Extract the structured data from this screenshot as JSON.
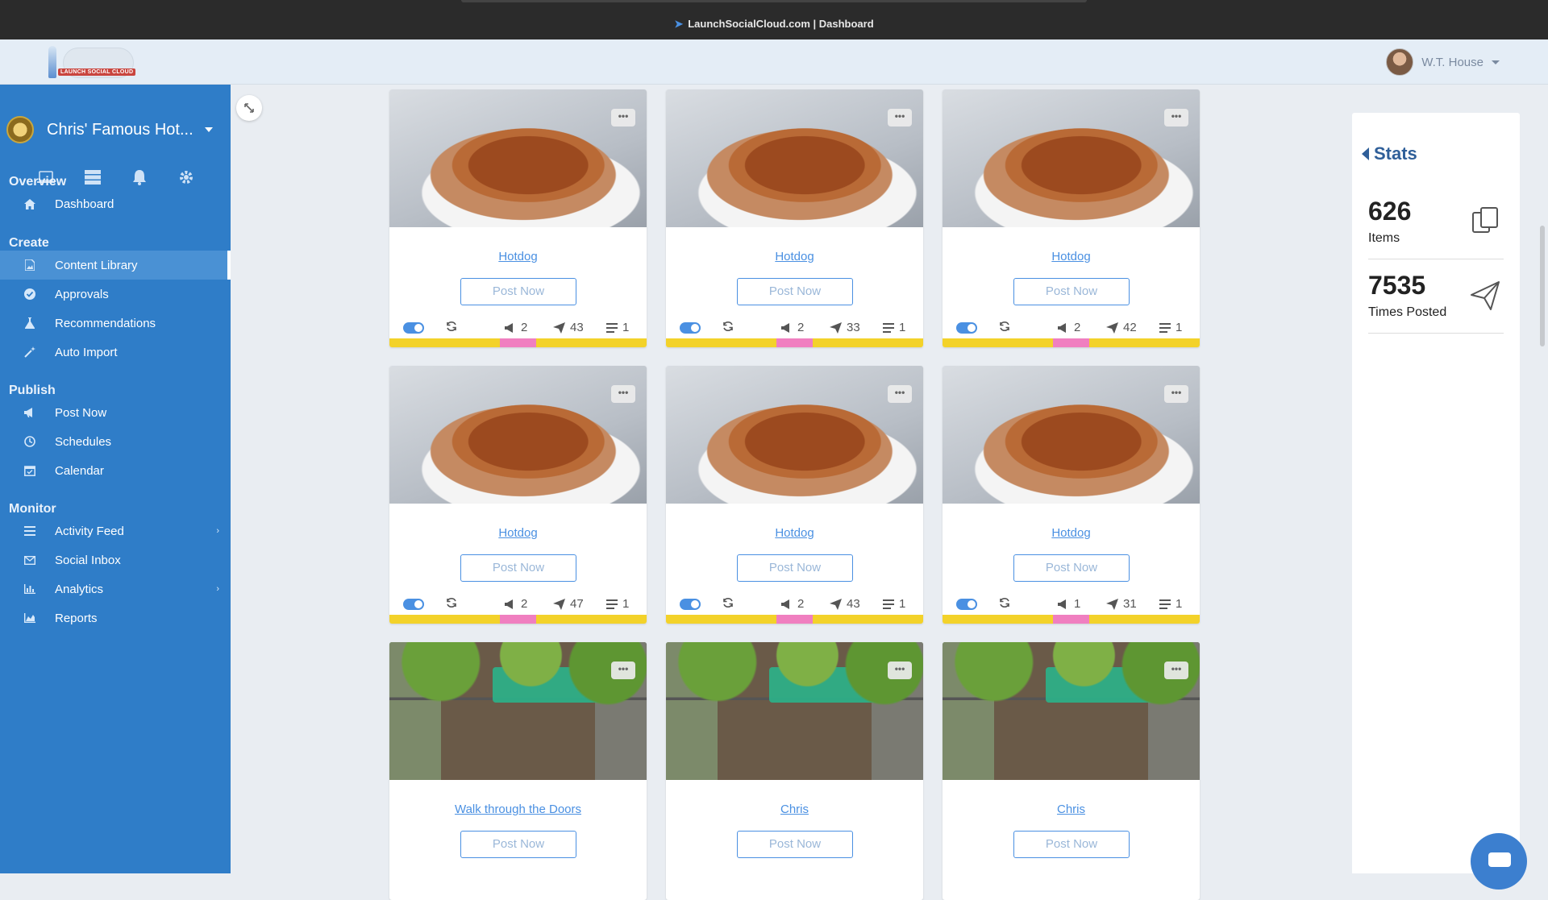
{
  "window": {
    "title": "LaunchSocialCloud.com | Dashboard"
  },
  "header": {
    "user_name": "W.T. House"
  },
  "sidebar": {
    "account_name": "Chris' Famous Hot...",
    "quick_icons": [
      "laptop-icon",
      "server-icon",
      "bell-icon",
      "gear-icon"
    ],
    "sections": {
      "overview": "Overview",
      "create": "Create",
      "publish": "Publish",
      "monitor": "Monitor"
    },
    "items": {
      "dashboard": "Dashboard",
      "content_library": "Content Library",
      "approvals": "Approvals",
      "recommendations": "Recommendations",
      "auto_import": "Auto Import",
      "post_now": "Post Now",
      "schedules": "Schedules",
      "calendar": "Calendar",
      "activity_feed": "Activity Feed",
      "social_inbox": "Social Inbox",
      "analytics": "Analytics",
      "reports": "Reports"
    },
    "active_item": "Content Library"
  },
  "cards": [
    {
      "title": "Hotdog",
      "button": "Post Now",
      "shouts": "2",
      "posts": "43",
      "lines": "1",
      "image": "hotdog"
    },
    {
      "title": "Hotdog",
      "button": "Post Now",
      "shouts": "2",
      "posts": "33",
      "lines": "1",
      "image": "hotdog"
    },
    {
      "title": "Hotdog",
      "button": "Post Now",
      "shouts": "2",
      "posts": "42",
      "lines": "1",
      "image": "hotdog"
    },
    {
      "title": "Hotdog",
      "button": "Post Now",
      "shouts": "2",
      "posts": "47",
      "lines": "1",
      "image": "hotdog"
    },
    {
      "title": "Hotdog",
      "button": "Post Now",
      "shouts": "2",
      "posts": "43",
      "lines": "1",
      "image": "hotdog"
    },
    {
      "title": "Hotdog",
      "button": "Post Now",
      "shouts": "1",
      "posts": "31",
      "lines": "1",
      "image": "hotdog"
    },
    {
      "title": "Walk through the Doors",
      "button": "Post Now",
      "image": "storefront"
    },
    {
      "title": "Chris",
      "button": "Post Now",
      "image": "storefront"
    },
    {
      "title": "Chris",
      "button": "Post Now",
      "image": "storefront"
    }
  ],
  "stats": {
    "heading": "Stats",
    "items_count": "626",
    "items_label": "Items",
    "posted_count": "7535",
    "posted_label": "Times Posted"
  },
  "colors": {
    "sidebar": "#2f7dc8",
    "accent": "#4a90e2",
    "bar_yellow": "#f3d22a",
    "bar_pink": "#f07fc0"
  }
}
